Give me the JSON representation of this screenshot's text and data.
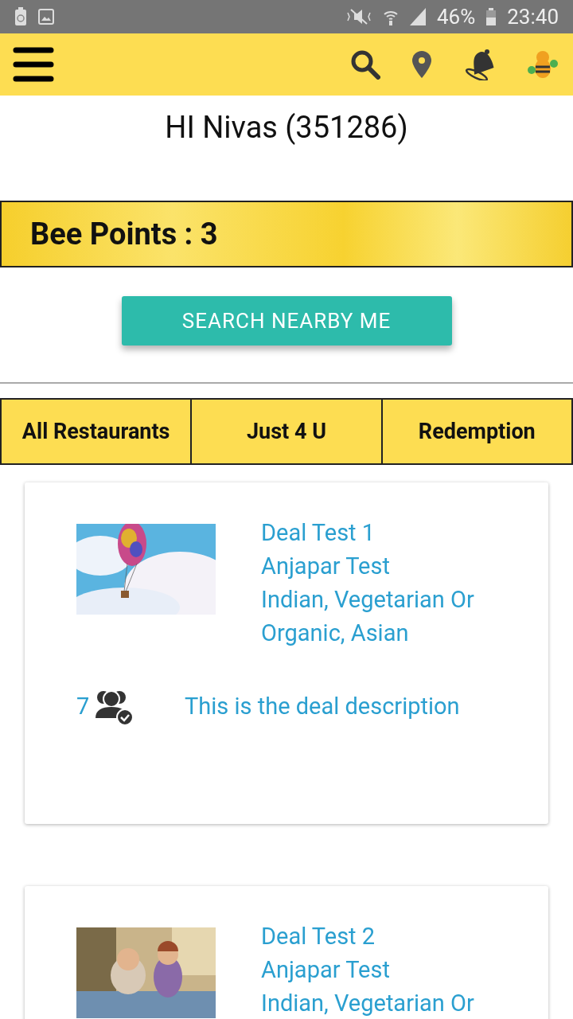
{
  "status_bar": {
    "battery_percent": "46%",
    "time": "23:40"
  },
  "greeting": "HI Nivas (351286)",
  "points_banner": "Bee Points : 3",
  "search_button": "SEARCH NEARBY ME",
  "tabs": [
    {
      "label": "All Restaurants",
      "selected": false
    },
    {
      "label": "Just 4 U",
      "selected": false
    },
    {
      "label": "Redemption",
      "selected": false
    }
  ],
  "deals": [
    {
      "title": "Deal Test 1",
      "restaurant": "Anjapar Test",
      "cuisine": "Indian, Vegetarian Or Organic, Asian",
      "count": "7",
      "description": "This is the deal description"
    },
    {
      "title": "Deal Test 2",
      "restaurant": "Anjapar Test",
      "cuisine": "Indian, Vegetarian Or"
    }
  ]
}
